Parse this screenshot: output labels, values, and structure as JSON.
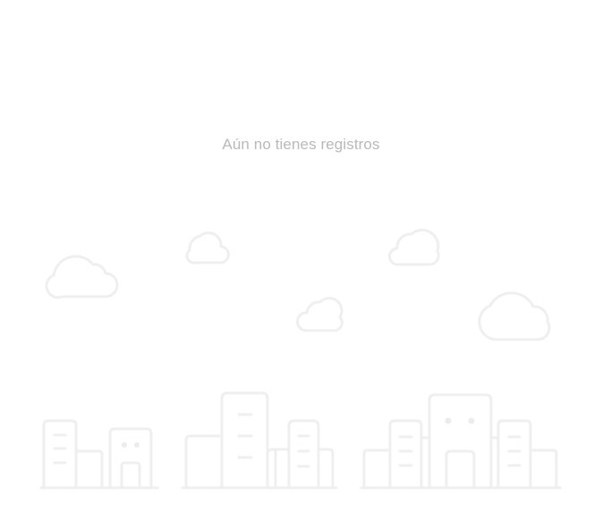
{
  "empty_state": {
    "message": "Aún no tienes registros",
    "illustration_icon": "city-skyline-icon",
    "text_color": "#b9b9b9",
    "line_color": "#efefef"
  }
}
